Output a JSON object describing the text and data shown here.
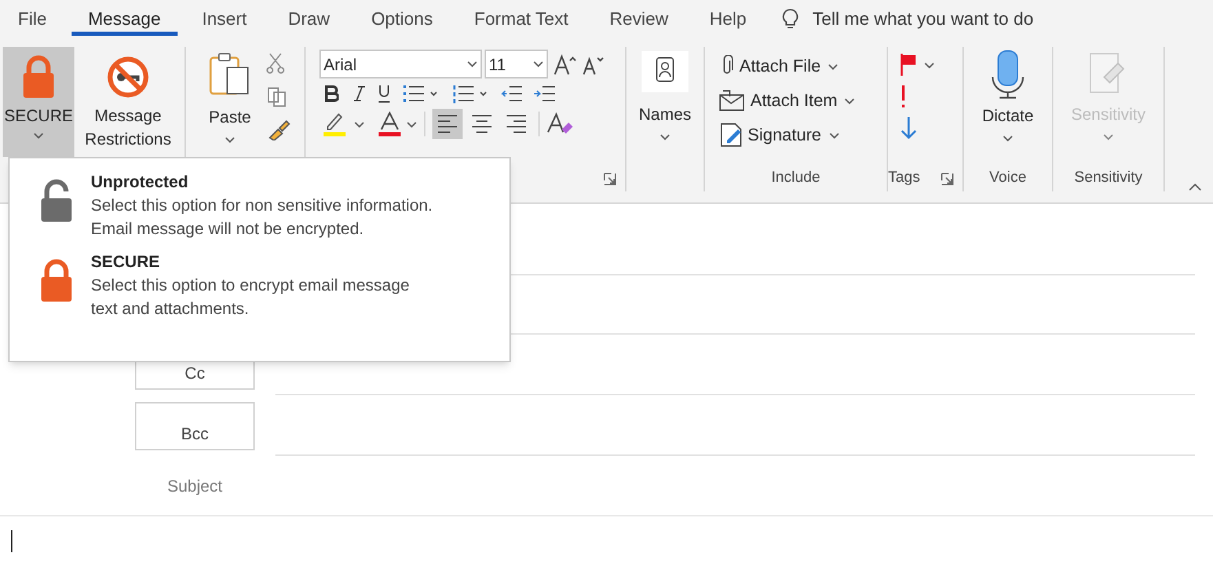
{
  "tabs": [
    {
      "label": "File",
      "selected": false
    },
    {
      "label": "Message",
      "selected": true
    },
    {
      "label": "Insert",
      "selected": false
    },
    {
      "label": "Draw",
      "selected": false
    },
    {
      "label": "Options",
      "selected": false
    },
    {
      "label": "Format Text",
      "selected": false
    },
    {
      "label": "Review",
      "selected": false
    },
    {
      "label": "Help",
      "selected": false
    }
  ],
  "tell_me": {
    "text": "Tell me what you want to do"
  },
  "ribbon": {
    "security": [
      {
        "label": "SECURE",
        "kind": "secure",
        "selected": true
      },
      {
        "label": "Message Restrictions",
        "kind": "restrictions",
        "selected": false
      }
    ],
    "clipboard": {
      "paste": "Paste"
    },
    "font": {
      "family": "Arial",
      "size": "11"
    },
    "alignment": [
      {
        "kind": "left",
        "selected": true
      },
      {
        "kind": "center",
        "selected": false
      },
      {
        "kind": "right",
        "selected": false
      }
    ],
    "names": {
      "button": "Names"
    },
    "include": {
      "items": [
        {
          "label": "Attach File",
          "kind": "file"
        },
        {
          "label": "Attach Item",
          "kind": "item"
        },
        {
          "label": "Signature",
          "kind": "signature"
        }
      ],
      "label": "Include"
    },
    "tags": {
      "label": "Tags"
    },
    "voice": {
      "button": "Dictate",
      "label": "Voice"
    },
    "sensitivity": {
      "button": "Sensitivity",
      "disabled": true,
      "label": "Sensitivity"
    }
  },
  "security_menu": {
    "options": [
      {
        "kind": "unprotected",
        "title": "Unprotected",
        "lines": [
          "Select this option for non sensitive information.",
          "Email message will not be encrypted."
        ]
      },
      {
        "kind": "secure",
        "title": "SECURE",
        "lines": [
          "Select this option to encrypt email message",
          "text and attachments."
        ]
      }
    ]
  },
  "compose": {
    "fields": [
      {
        "label": "Cc",
        "kind": "button"
      },
      {
        "label": "Bcc",
        "kind": "button"
      },
      {
        "label": "Subject",
        "kind": "plain"
      }
    ]
  }
}
